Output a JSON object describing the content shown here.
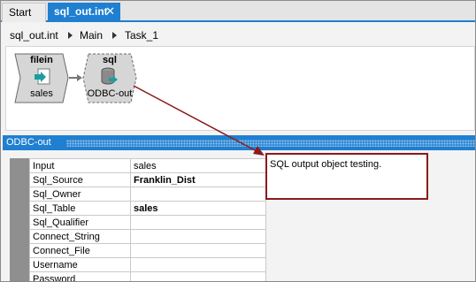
{
  "tabs": [
    {
      "label": "Start"
    },
    {
      "label": "sql_out.int",
      "close": "✕"
    }
  ],
  "breadcrumb": [
    "sql_out.int",
    "Main",
    "Task_1"
  ],
  "nodes": {
    "filein": {
      "title": "filein",
      "label": "sales"
    },
    "sql": {
      "title": "sql",
      "label": "ODBC-out"
    }
  },
  "section": {
    "title": "ODBC-out"
  },
  "properties": [
    {
      "name": "Input",
      "value": "sales",
      "bold": false
    },
    {
      "name": "Sql_Source",
      "value": "Franklin_Dist",
      "bold": true
    },
    {
      "name": "Sql_Owner",
      "value": "",
      "bold": false
    },
    {
      "name": "Sql_Table",
      "value": "sales",
      "bold": true
    },
    {
      "name": "Sql_Qualifier",
      "value": "",
      "bold": false
    },
    {
      "name": "Connect_String",
      "value": "",
      "bold": false
    },
    {
      "name": "Connect_File",
      "value": "",
      "bold": false
    },
    {
      "name": "Username",
      "value": "",
      "bold": false
    },
    {
      "name": "Password",
      "value": "",
      "bold": false
    }
  ],
  "note": {
    "text": "SQL output object testing."
  },
  "colors": {
    "accent": "#1f7fd1",
    "annotation": "#8b1a1a",
    "icon_teal": "#1a9ea0"
  },
  "icons": {
    "filein": "file-input-icon",
    "sql": "database-icon",
    "connector": "right-arrow"
  }
}
